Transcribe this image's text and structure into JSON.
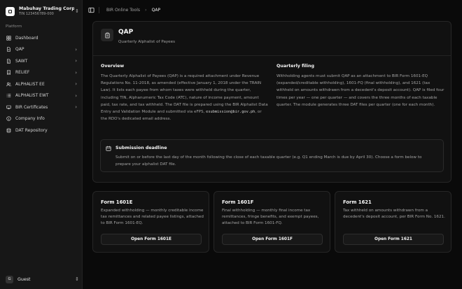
{
  "sidebar": {
    "org": {
      "name": "Mabuhay Trading Corp...",
      "tin": "TIN 123456789-000"
    },
    "group_label": "Platform",
    "items": [
      {
        "label": "Dashboard",
        "icon": "dashboard-icon",
        "has_chevron": false
      },
      {
        "label": "QAP",
        "icon": "file-icon",
        "has_chevron": true
      },
      {
        "label": "SAWT",
        "icon": "document-icon",
        "has_chevron": true
      },
      {
        "label": "RELIEF",
        "icon": "receipt-icon",
        "has_chevron": true
      },
      {
        "label": "ALPHALIST EE",
        "icon": "users-icon",
        "has_chevron": true
      },
      {
        "label": "ALPHALIST EWT",
        "icon": "list-icon",
        "has_chevron": true
      },
      {
        "label": "BIR Certificates",
        "icon": "certificate-icon",
        "has_chevron": true
      },
      {
        "label": "Company Info",
        "icon": "info-icon",
        "has_chevron": false
      },
      {
        "label": "DAT Repository",
        "icon": "database-icon",
        "has_chevron": false
      }
    ],
    "user": {
      "initial": "G",
      "name": "Guest"
    }
  },
  "header": {
    "breadcrumb": {
      "parent": "BIR Online Tools",
      "separator": "›",
      "current": "QAP"
    }
  },
  "hero": {
    "title": "QAP",
    "subtitle": "Quarterly Alphalist of Payees",
    "overview": {
      "heading": "Overview",
      "text": "The Quarterly Alphalist of Payees (QAP) is a required attachment under Revenue Regulations No. 11-2018, as amended (effective January 1, 2018 under the TRAIN Law). It lists each payee from whom taxes were withheld during the quarter, including TIN, Alphanumeric Tax Code (ATC), nature of income payment, amount paid, tax rate, and tax withheld. The DAT file is prepared using the BIR Alphalist Data Entry and Validation Module and submitted via eFPS,",
      "email": "esubmission@bir.gov.ph",
      "text_after": ", or the RDO's dedicated email address."
    },
    "filing": {
      "heading": "Quarterly filing",
      "text": "Withholding agents must submit QAP as an attachment to BIR Form 1601-EQ (expanded/creditable withholding), 1601-FQ (final withholding), and 1621 (tax withheld on amounts withdrawn from a decedent's deposit account). QAP is filed four times per year — one per quarter — and covers the three months of each taxable quarter. The module generates three DAT files per quarter (one for each month)."
    },
    "deadline": {
      "title": "Submission deadline",
      "text": "Submit on or before the last day of the month following the close of each taxable quarter (e.g. Q1 ending March is due by April 30). Choose a form below to prepare your alphalist DAT file."
    }
  },
  "forms": [
    {
      "title": "Form 1601E",
      "description": "Expanded withholding — monthly creditable income tax remittances and related payee listings, attached to BIR Form 1601-EQ.",
      "button": "Open Form 1601E"
    },
    {
      "title": "Form 1601F",
      "description": "Final withholding — monthly final income tax remittances, fringe benefits, and exempt payees, attached to BIR Form 1601-FQ.",
      "button": "Open Form 1601F"
    },
    {
      "title": "Form 1621",
      "description": "Tax withheld on amounts withdrawn from a decedent's deposit account, per BIR Form No. 1621.",
      "button": "Open Form 1621"
    }
  ],
  "colors": {
    "background": "#0a0a0a",
    "sidebar": "#171717",
    "card": "#111111",
    "border": "#262626",
    "text": "#fafafa",
    "muted": "#a3a3a3"
  }
}
